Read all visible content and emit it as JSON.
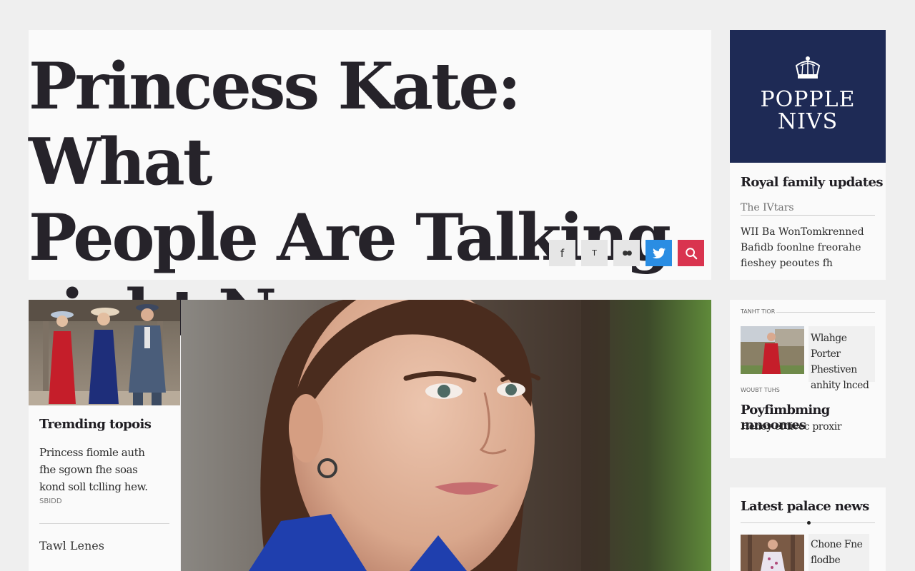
{
  "headline": {
    "title": "Princess Kate: What\nPeople Are Talking\nright Now"
  },
  "share": {
    "facebook_label": "f",
    "t_label": "T",
    "flickr_label": "●●"
  },
  "brand": {
    "logo_line1": "POPPLE",
    "logo_line2": "NIVS",
    "title": "Royal family updates",
    "source": "The IVtars",
    "body": "WII Ba WonTomkrenned\nBafidb foonlne freorahe\nfieshey peoutes fh"
  },
  "trend_card": {
    "title": "Tremding topois",
    "body": "Princess fiomle auth\nfhe sgown fhe soas\nkond soll tclling hew.",
    "date": "SBIDD",
    "footer": "Tawl Lenes"
  },
  "trending": {
    "section_label": "TANHT TIOR",
    "caption": "Wlahge Porter\nPhestiven\nanhity lnced",
    "sub_label": "WOUBT TUHS",
    "title": "Poyfimbming mnoomes",
    "subtitle": "Henoy ef fivec proxir"
  },
  "latest": {
    "title": "Latest palace news",
    "caption": "Chone Fne\nflodbe fepias"
  },
  "colors": {
    "brand_navy": "#1e2a55",
    "twitter_blue": "#2a8de3",
    "search_red": "#d9344f"
  }
}
